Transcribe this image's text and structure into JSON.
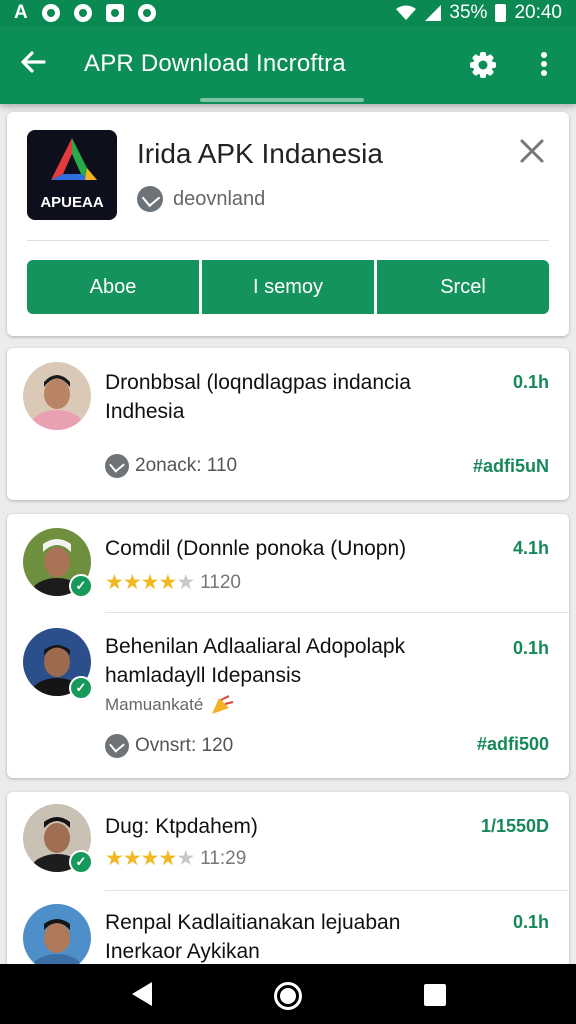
{
  "status_bar": {
    "left_text": "A",
    "battery": "35%",
    "time": "20:40"
  },
  "app_bar": {
    "title": "APR Download Incroftra",
    "icons": [
      "back-arrow-icon",
      "settings-icon",
      "more-vert-icon"
    ]
  },
  "app_card": {
    "logo_text": "APUEAA",
    "name": "Irida APK Indanesia",
    "subtitle": "deovnland",
    "buttons": [
      "Aboe",
      "I semoy",
      "Srcel"
    ]
  },
  "feed": [
    {
      "title": "Dronbbsal (loqndlagpas indancia Indhesia",
      "time": "0.1h",
      "meta": "2onack: 110",
      "tag": "#adfi5uN"
    },
    {
      "title": "Comdil (Donnle ponoka (Unopn)",
      "time": "4.1h",
      "rating_stars": 4,
      "rating_count": "1120"
    },
    {
      "title": "Behenilan Adlaaliaral Adopolapk hamladayll Idepansis",
      "time": "0.1h",
      "subline": "Mamuankaté",
      "meta": "Ovnsrt: 120",
      "tag": "#adfi500"
    },
    {
      "title": "Dug: Ktpdahem)",
      "time": "1/1550D",
      "rating_stars": 4,
      "rating_count": "11:29"
    },
    {
      "title": "Renpal Kadlaitianakan lejuaban Inerkaor Aykikan",
      "time": "0.1h"
    }
  ],
  "colors": {
    "primary": "#0b8f57",
    "accent_text": "#16885a",
    "star": "#f2b824"
  },
  "nav_bar": {
    "icons": [
      "nav-back-icon",
      "nav-home-icon",
      "nav-recents-icon"
    ]
  }
}
